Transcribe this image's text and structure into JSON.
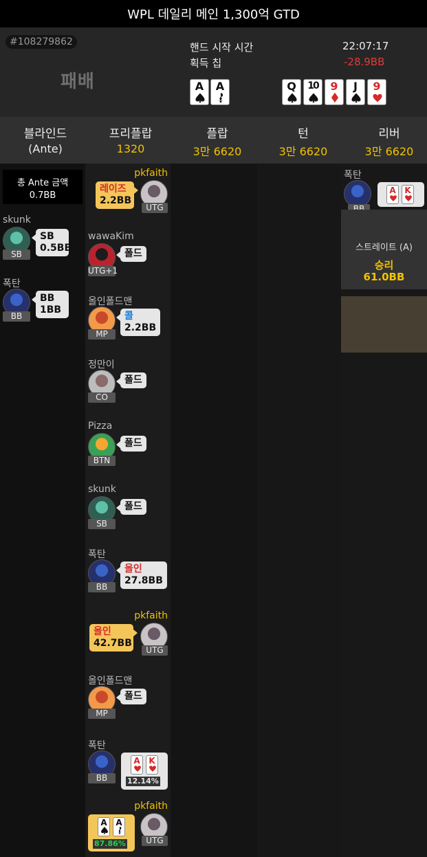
{
  "header": {
    "title": "WPL 데일리 메인 1,300억 GTD"
  },
  "hand": {
    "id": "#108279862",
    "result": "패배",
    "start_label": "핸드 시작 시간",
    "start_time": "22:07:17",
    "chips_label": "획득 칩",
    "chips_value": "-28.9BB"
  },
  "hero_cards": [
    {
      "rank": "A",
      "suit": "spade"
    },
    {
      "rank": "A",
      "suit": "club"
    }
  ],
  "board": [
    {
      "rank": "Q",
      "suit": "spade"
    },
    {
      "rank": "10",
      "suit": "spade"
    },
    {
      "rank": "9",
      "suit": "diamond"
    },
    {
      "rank": "J",
      "suit": "spade"
    },
    {
      "rank": "9",
      "suit": "heart"
    }
  ],
  "streets": [
    {
      "name": "블라인드",
      "value": "(Ante)"
    },
    {
      "name": "프리플랍",
      "value": "1320"
    },
    {
      "name": "플랍",
      "value": "3만 6620"
    },
    {
      "name": "턴",
      "value": "3만 6620"
    },
    {
      "name": "리버",
      "value": "3만 6620"
    }
  ],
  "ante": {
    "label": "총 Ante 금액",
    "value": "0.7BB"
  },
  "blinds": [
    {
      "name": "skunk",
      "pos": "SB",
      "line1": "SB",
      "line2": "0.5BB"
    },
    {
      "name": "폭탄",
      "pos": "BB",
      "line1": "BB",
      "line2": "1BB"
    }
  ],
  "actions": [
    {
      "name": "pkfaith",
      "pos": "UTG",
      "action": "레이즈",
      "amount": "2.2BB"
    },
    {
      "name": "wawaKim",
      "pos": "UTG+1",
      "action": "폴드",
      "amount": ""
    },
    {
      "name": "올인폴드맨",
      "pos": "MP",
      "action": "콜",
      "amount": "2.2BB"
    },
    {
      "name": "정만이",
      "pos": "CO",
      "action": "폴드",
      "amount": ""
    },
    {
      "name": "Pizza",
      "pos": "BTN",
      "action": "폴드",
      "amount": ""
    },
    {
      "name": "skunk",
      "pos": "SB",
      "action": "폴드",
      "amount": ""
    },
    {
      "name": "폭탄",
      "pos": "BB",
      "action": "올인",
      "amount": "27.8BB"
    },
    {
      "name": "pkfaith",
      "pos": "UTG",
      "action": "올인",
      "amount": "42.7BB"
    },
    {
      "name": "올인폴드맨",
      "pos": "MP",
      "action": "폴드",
      "amount": ""
    },
    {
      "name": "폭탄",
      "pos": "BB",
      "equity": "12.14%",
      "cards": [
        {
          "rank": "A",
          "suit": "heart"
        },
        {
          "rank": "K",
          "suit": "heart"
        }
      ]
    },
    {
      "name": "pkfaith",
      "pos": "UTG",
      "equity": "87.86%",
      "cards": [
        {
          "rank": "A",
          "suit": "spade"
        },
        {
          "rank": "A",
          "suit": "club"
        }
      ]
    }
  ],
  "showdown": {
    "winner": {
      "name": "폭탄",
      "pos": "BB",
      "cards": [
        {
          "rank": "A",
          "suit": "heart"
        },
        {
          "rank": "K",
          "suit": "heart"
        }
      ],
      "best": [
        {
          "rank": "Q",
          "suit": "spade"
        },
        {
          "rank": "10",
          "suit": "spade"
        },
        {
          "rank": "9",
          "suit": "diamond"
        },
        {
          "rank": "J",
          "suit": "spade"
        },
        {
          "rank": "9",
          "suit": "heart"
        }
      ],
      "hand_name": "스트레이트 (A)",
      "result": "승리",
      "amount": "61.0BB"
    },
    "loser": {
      "name": "pkfaith",
      "pos": "UTG",
      "cards": [
        {
          "rank": "A",
          "suit": "spade"
        },
        {
          "rank": "A",
          "suit": "club"
        }
      ]
    }
  },
  "colors": {
    "gold": "#f2c200",
    "negative": "#e03a3a",
    "raise_bg": "#f4c65a",
    "equity_win": "#26d04a",
    "equity_lose": "#e8e8e8"
  }
}
